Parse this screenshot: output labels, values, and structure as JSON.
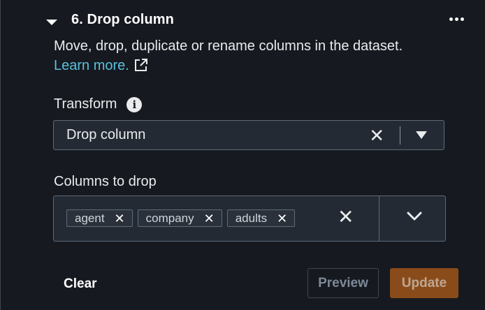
{
  "step": {
    "title": "6. Drop column",
    "description": "Move, drop, duplicate or rename columns in the dataset.",
    "learn_more": "Learn more."
  },
  "transform": {
    "label": "Transform",
    "selected": "Drop column"
  },
  "columns_to_drop": {
    "label": "Columns to drop",
    "tags": [
      "agent",
      "company",
      "adults"
    ]
  },
  "actions": {
    "clear": "Clear",
    "preview": "Preview",
    "update": "Update"
  },
  "icons": {
    "collapse": "caret-down-icon",
    "menu": "ellipsis-icon",
    "external_link": "external-link-icon",
    "info": "info-icon",
    "clear": "close-icon",
    "dropdown": "triangle-down-icon",
    "expand": "chevron-down-icon"
  },
  "colors": {
    "background": "#16191f",
    "link": "#5bc0de",
    "update_button": "#8a4b1a"
  }
}
